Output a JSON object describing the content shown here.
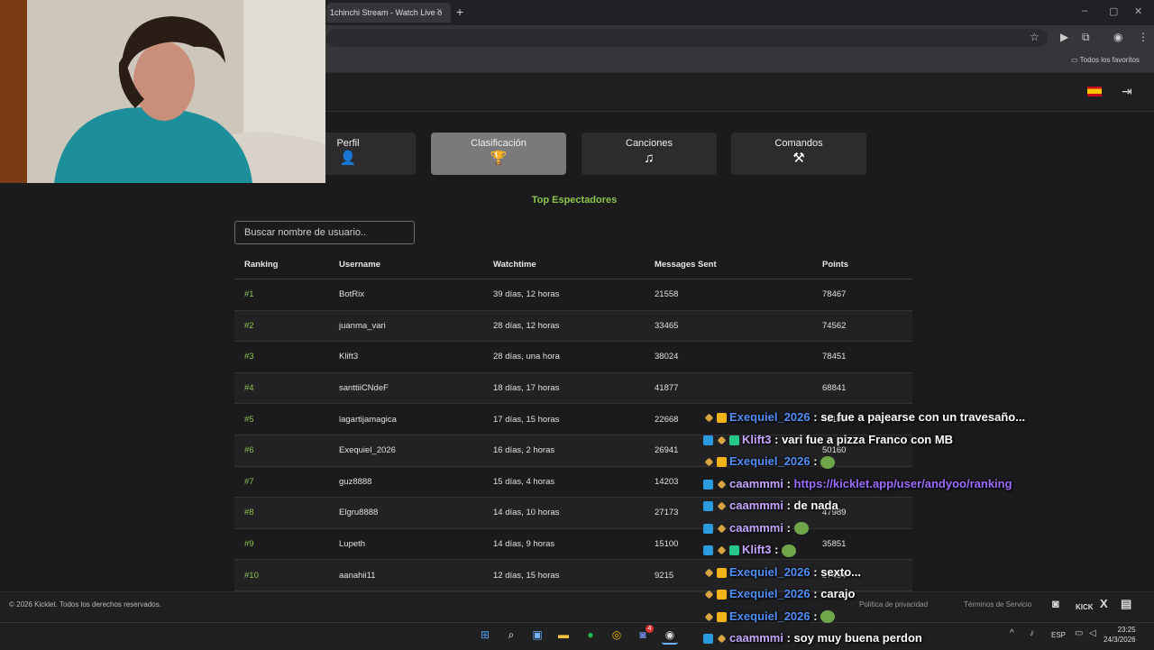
{
  "browser": {
    "tab_title": "1chinchi Stream - Watch Live o",
    "tab_close": "×",
    "new_tab": "+",
    "favorites_label": "Todos los favoritos"
  },
  "site": {
    "language_flag": "spain-flag-icon",
    "tabs": [
      {
        "label": "Perfil",
        "icon": "user-icon",
        "glyph": "👤",
        "active": false
      },
      {
        "label": "Clasificación",
        "icon": "trophy-icon",
        "glyph": "🏆",
        "active": true
      },
      {
        "label": "Canciones",
        "icon": "music-list-icon",
        "glyph": "♫",
        "active": false
      },
      {
        "label": "Comandos",
        "icon": "tools-icon",
        "glyph": "⚒",
        "active": false
      }
    ],
    "section_title": "Top Espectadores",
    "search_placeholder": "Buscar nombre de usuario..",
    "accent_color": "#8bc34a"
  },
  "table": {
    "headers": [
      "Ranking",
      "Username",
      "Watchtime",
      "Messages Sent",
      "Points"
    ],
    "rows": [
      {
        "rank": "#1",
        "username": "BotRix",
        "watchtime": "39 días, 12 horas",
        "messages": "21558",
        "points": "78467"
      },
      {
        "rank": "#2",
        "username": "juanma_vari",
        "watchtime": "28 días, 12 horas",
        "messages": "33465",
        "points": "74562"
      },
      {
        "rank": "#3",
        "username": "Klift3",
        "watchtime": "28 días, una hora",
        "messages": "38024",
        "points": "78451"
      },
      {
        "rank": "#4",
        "username": "santtiiCNdeF",
        "watchtime": "18 días, 17 horas",
        "messages": "41877",
        "points": "68841"
      },
      {
        "rank": "#5",
        "username": "lagartijamagica",
        "watchtime": "17 días, 15 horas",
        "messages": "22668",
        "points": "46100"
      },
      {
        "rank": "#6",
        "username": "Exequiel_2026",
        "watchtime": "16 días, 2 horas",
        "messages": "26941",
        "points": "50160"
      },
      {
        "rank": "#7",
        "username": "guz8888",
        "watchtime": "15 días, 4 horas",
        "messages": "14203",
        "points": ""
      },
      {
        "rank": "#8",
        "username": "Elgru8888",
        "watchtime": "14 días, 10 horas",
        "messages": "27173",
        "points": "47989"
      },
      {
        "rank": "#9",
        "username": "Lupeth",
        "watchtime": "14 días, 9 horas",
        "messages": "15100",
        "points": "35851"
      },
      {
        "rank": "#10",
        "username": "aanahii11",
        "watchtime": "12 días, 15 horas",
        "messages": "9215",
        "points": "27434"
      }
    ]
  },
  "footer": {
    "copyright": "© 2026 Kicklet. Todos los derechos reservados.",
    "privacy": "Política de privacidad",
    "terms": "Términos de Servicio",
    "kick_label": "KICK",
    "x_label": "X"
  },
  "taskbar": {
    "lang": "ESP",
    "time": "23:25",
    "date": "24/3/2026",
    "badge_count": "4"
  },
  "chat": [
    {
      "user": "Exequiel_2026",
      "color": "blue",
      "badges": [
        "pencil",
        "crown"
      ],
      "text": "se fue a pajearse con un travesaño..."
    },
    {
      "user": "Klift3",
      "color": "lilac",
      "badges": [
        "blue",
        "pencil",
        "green"
      ],
      "text": "vari fue a pizza Franco con MB"
    },
    {
      "user": "Exequiel_2026",
      "color": "blue",
      "badges": [
        "pencil",
        "crown"
      ],
      "text": "",
      "emote": true
    },
    {
      "user": "caammmi",
      "color": "lilac",
      "badges": [
        "blue",
        "pencil"
      ],
      "text": "",
      "link": "https://kicklet.app/user/andyoo/ranking"
    },
    {
      "user": "caammmi",
      "color": "lilac",
      "badges": [
        "blue",
        "pencil"
      ],
      "text": "de nada"
    },
    {
      "user": "caammmi",
      "color": "lilac",
      "badges": [
        "blue",
        "pencil"
      ],
      "text": "",
      "emote": true
    },
    {
      "user": "Klift3",
      "color": "lilac",
      "badges": [
        "blue",
        "pencil",
        "green"
      ],
      "text": "",
      "emote": true
    },
    {
      "user": "Exequiel_2026",
      "color": "blue",
      "badges": [
        "pencil",
        "crown"
      ],
      "text": "sexto..."
    },
    {
      "user": "Exequiel_2026",
      "color": "blue",
      "badges": [
        "pencil",
        "crown"
      ],
      "text": "carajo"
    },
    {
      "user": "Exequiel_2026",
      "color": "blue",
      "badges": [
        "pencil",
        "crown"
      ],
      "text": "",
      "emote": true
    },
    {
      "user": "caammmi",
      "color": "lilac",
      "badges": [
        "blue",
        "pencil"
      ],
      "text": "soy muy buena perdon"
    }
  ]
}
